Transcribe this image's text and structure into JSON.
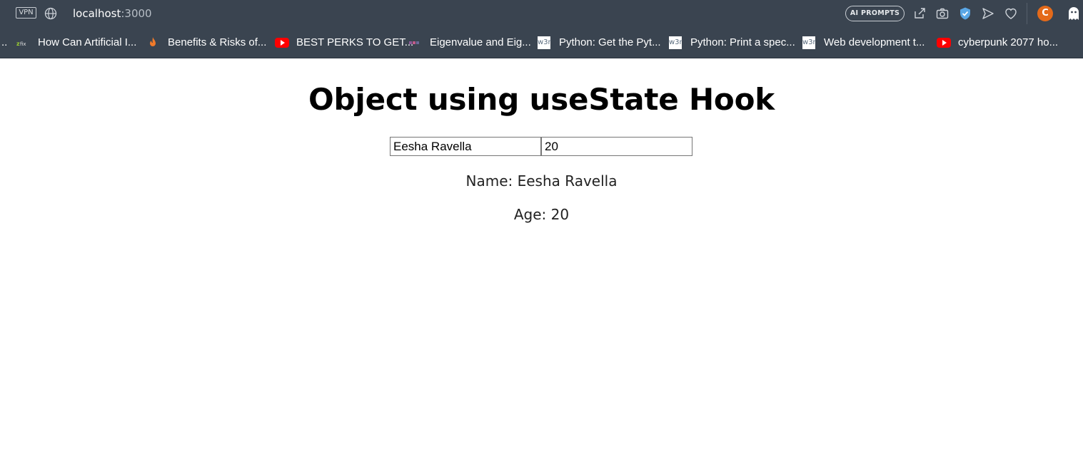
{
  "browser": {
    "vpn_label": "VPN",
    "url_host": "localhost",
    "url_port": ":3000",
    "ai_prompts_label": "AI PROMPTS",
    "profile_initial": "C",
    "icons": [
      "globe-icon",
      "share-icon",
      "camera-icon",
      "shield-icon",
      "send-icon",
      "heart-icon",
      "ghost-icon"
    ]
  },
  "bookmarks": {
    "overflow": "..",
    "items": [
      {
        "label": "How Can Artificial I...",
        "icon": "zfix-icon"
      },
      {
        "label": "Benefits & Risks of...",
        "icon": "flame-icon"
      },
      {
        "label": "BEST PERKS TO GET...",
        "icon": "youtube-icon"
      },
      {
        "label": "Eigenvalue and Eig...",
        "icon": "site-icon"
      },
      {
        "label": "Python: Get the Pyt...",
        "icon": "w3r-icon",
        "fav_text": "w3r"
      },
      {
        "label": "Python: Print a spec...",
        "icon": "w3r-icon",
        "fav_text": "w3r"
      },
      {
        "label": "Web development t...",
        "icon": "w3r-icon",
        "fav_text": "w3r"
      },
      {
        "label": "cyberpunk 2077 ho...",
        "icon": "youtube-icon"
      }
    ]
  },
  "page": {
    "title": "Object using useState Hook",
    "name_input_value": "Eesha Ravella",
    "age_input_value": "20",
    "name_line": "Name: Eesha Ravella",
    "age_line": "Age: 20"
  },
  "colors": {
    "chrome_bg": "#3a4450",
    "page_bg": "#ffffff",
    "youtube_red": "#ff0000",
    "profile_orange": "#e46a1a"
  }
}
